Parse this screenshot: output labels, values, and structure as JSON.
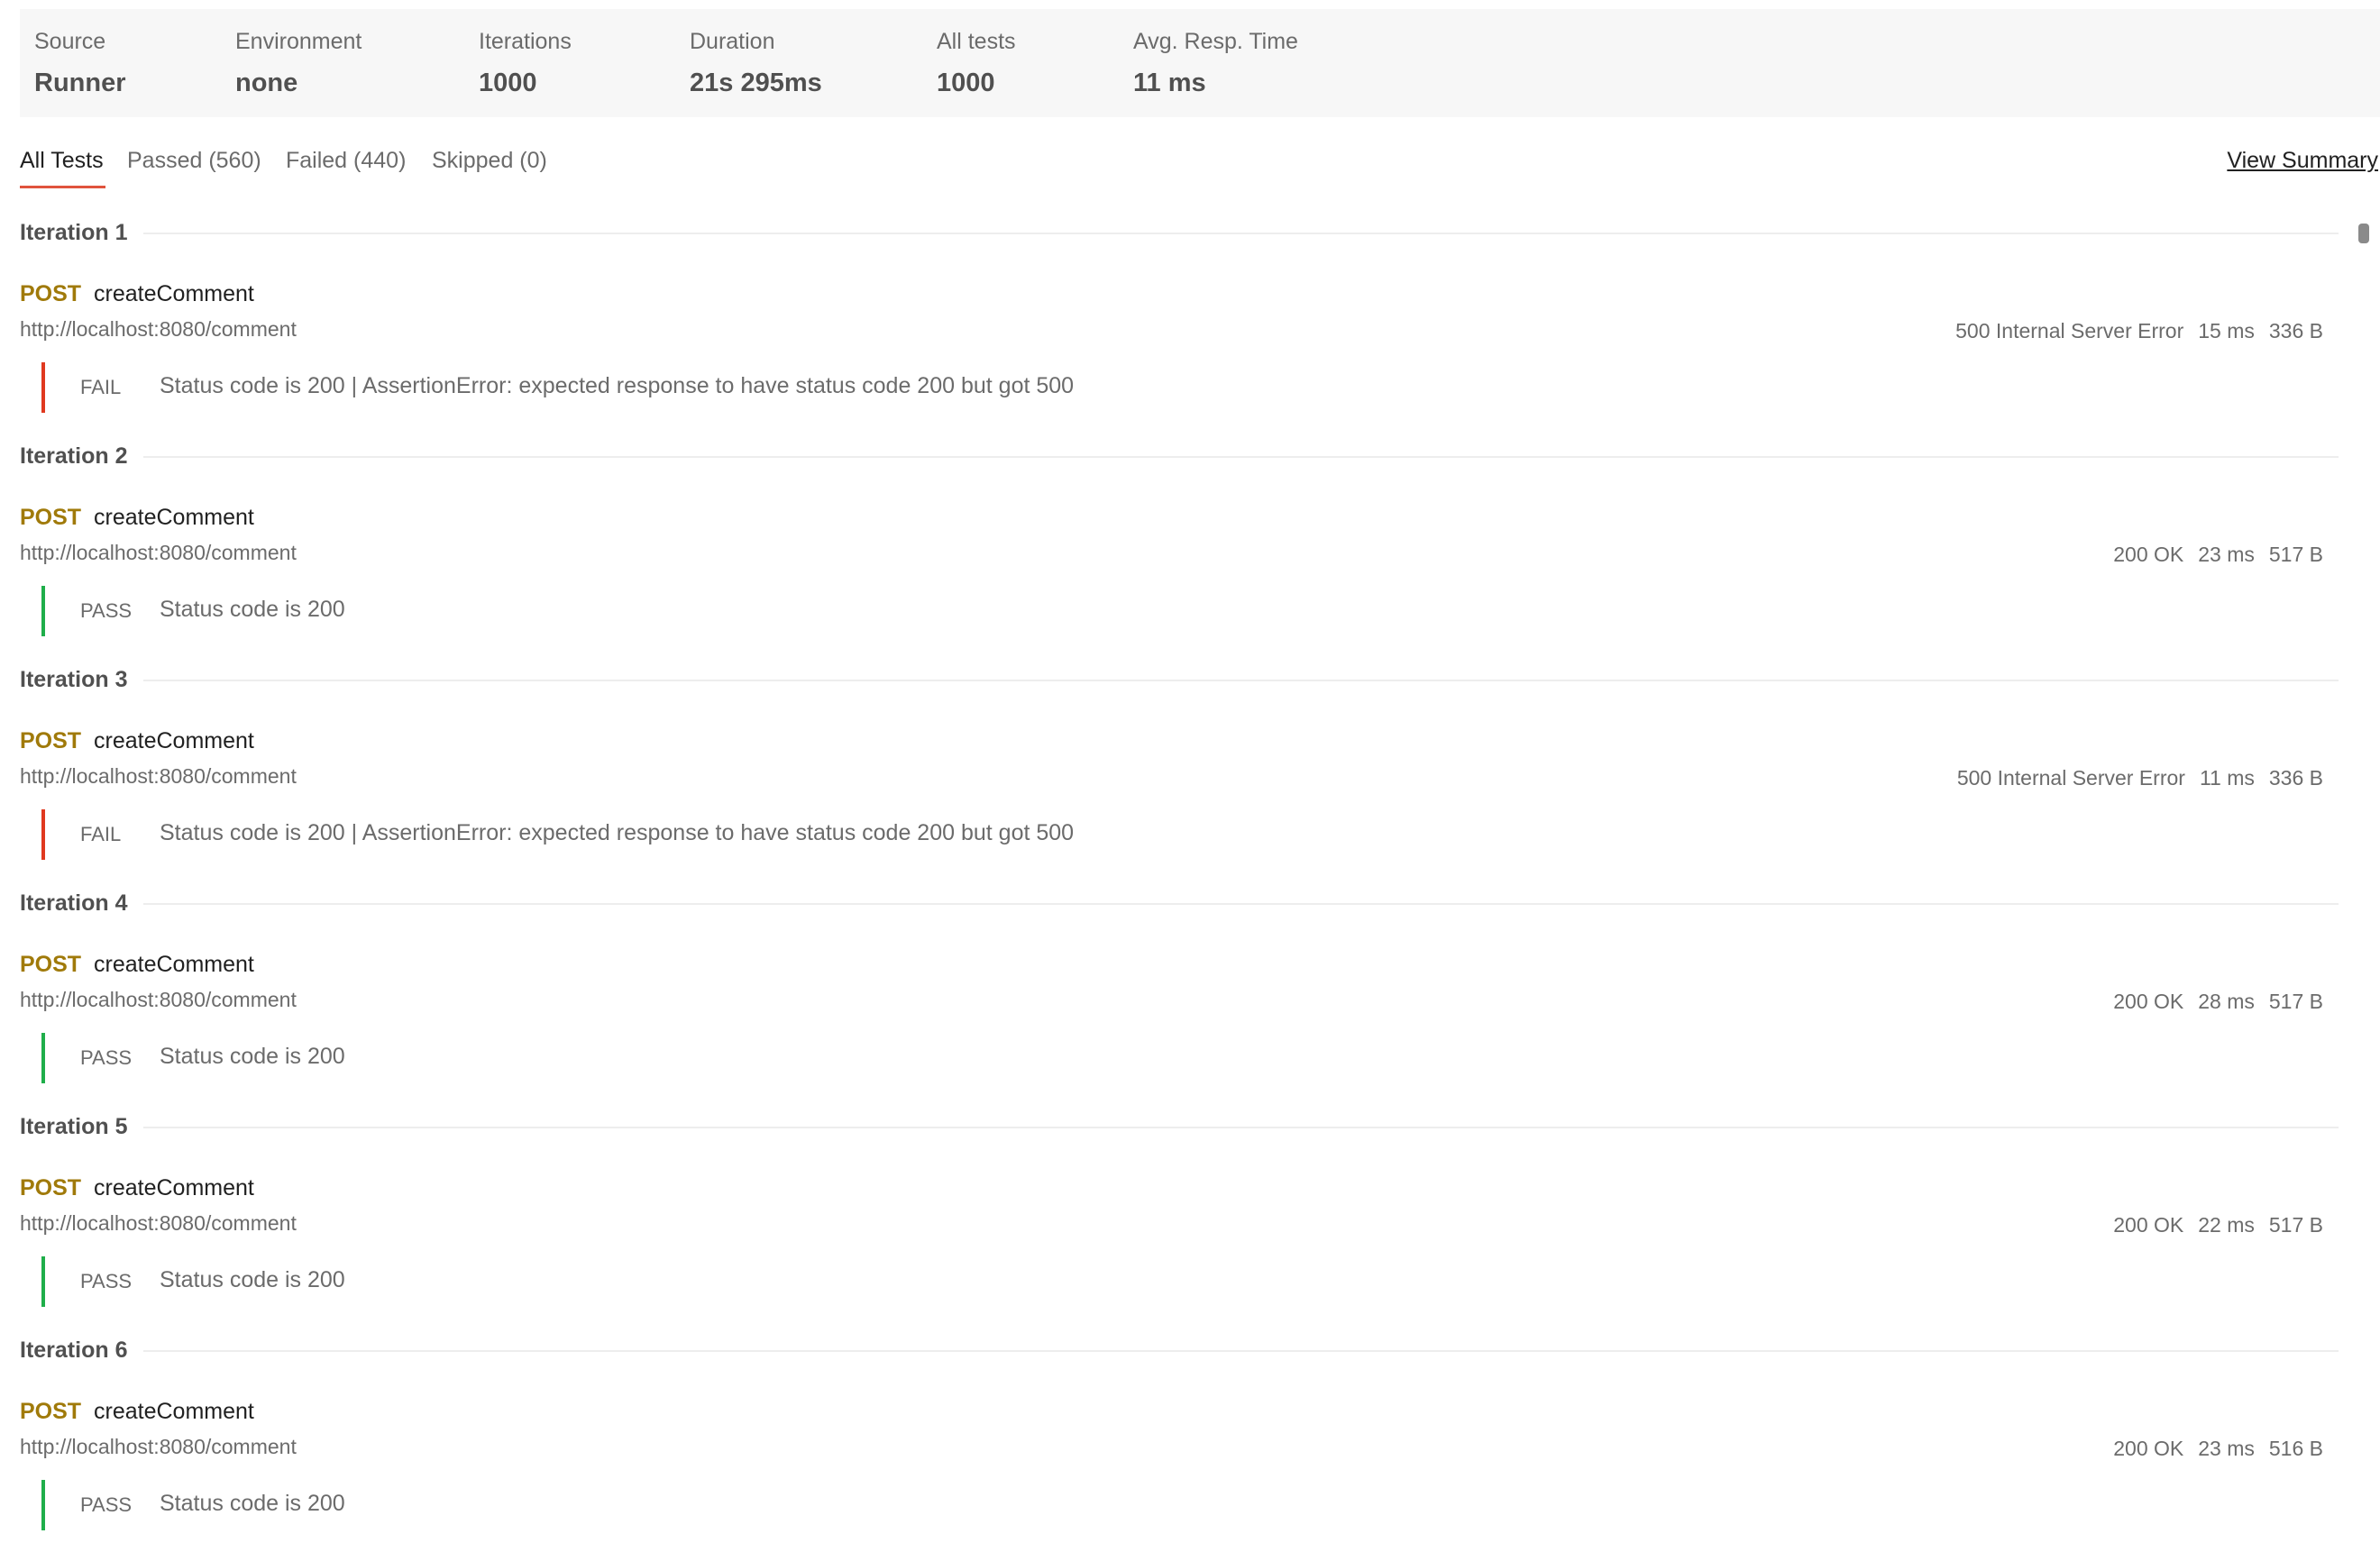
{
  "summary": {
    "source": {
      "label": "Source",
      "value": "Runner"
    },
    "environment": {
      "label": "Environment",
      "value": "none"
    },
    "iterations": {
      "label": "Iterations",
      "value": "1000"
    },
    "duration": {
      "label": "Duration",
      "value": "21s 295ms"
    },
    "all_tests": {
      "label": "All tests",
      "value": "1000"
    },
    "avg_resp_time": {
      "label": "Avg. Resp. Time",
      "value": "11 ms"
    }
  },
  "tabs": {
    "all": "All Tests",
    "passed": "Passed (560)",
    "failed": "Failed (440)",
    "skipped": "Skipped (0)",
    "view_summary": "View Summary"
  },
  "iterations": [
    {
      "title": "Iteration 1",
      "method": "POST",
      "name": "createComment",
      "url": "http://localhost:8080/comment",
      "status": "500 Internal Server Error",
      "time": "15 ms",
      "size": "336 B",
      "result": "FAIL",
      "result_text": "Status code is 200 | AssertionError: expected response to have status code 200 but got 500"
    },
    {
      "title": "Iteration 2",
      "method": "POST",
      "name": "createComment",
      "url": "http://localhost:8080/comment",
      "status": "200 OK",
      "time": "23 ms",
      "size": "517 B",
      "result": "PASS",
      "result_text": "Status code is 200"
    },
    {
      "title": "Iteration 3",
      "method": "POST",
      "name": "createComment",
      "url": "http://localhost:8080/comment",
      "status": "500 Internal Server Error",
      "time": "11 ms",
      "size": "336 B",
      "result": "FAIL",
      "result_text": "Status code is 200 | AssertionError: expected response to have status code 200 but got 500"
    },
    {
      "title": "Iteration 4",
      "method": "POST",
      "name": "createComment",
      "url": "http://localhost:8080/comment",
      "status": "200 OK",
      "time": "28 ms",
      "size": "517 B",
      "result": "PASS",
      "result_text": "Status code is 200"
    },
    {
      "title": "Iteration 5",
      "method": "POST",
      "name": "createComment",
      "url": "http://localhost:8080/comment",
      "status": "200 OK",
      "time": "22 ms",
      "size": "517 B",
      "result": "PASS",
      "result_text": "Status code is 200"
    },
    {
      "title": "Iteration 6",
      "method": "POST",
      "name": "createComment",
      "url": "http://localhost:8080/comment",
      "status": "200 OK",
      "time": "23 ms",
      "size": "516 B",
      "result": "PASS",
      "result_text": "Status code is 200"
    }
  ]
}
